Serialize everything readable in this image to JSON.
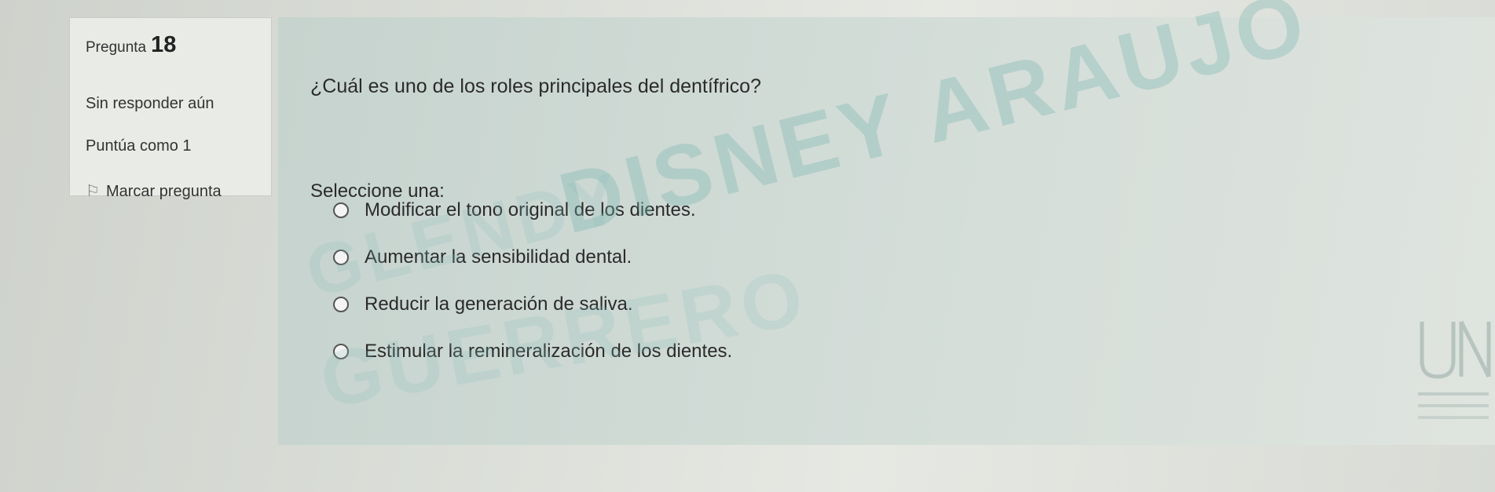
{
  "question_info": {
    "label": "Pregunta",
    "number": "18",
    "state": "Sin responder aún",
    "grade": "Puntúa como 1",
    "flag_label": "Marcar pregunta"
  },
  "question": {
    "text": "¿Cuál es uno de los roles principales del dentífrico?",
    "prompt": "Seleccione una:",
    "options": [
      {
        "label": "Modificar el tono original de los dientes."
      },
      {
        "label": "Aumentar la sensibilidad dental."
      },
      {
        "label": "Reducir la generación de saliva."
      },
      {
        "label": "Estimular la remineralización de los dientes."
      }
    ]
  },
  "watermark": {
    "line1": "DISNEY ARAUJO",
    "line2": "GLENDY",
    "line3": "GUERRERO"
  }
}
